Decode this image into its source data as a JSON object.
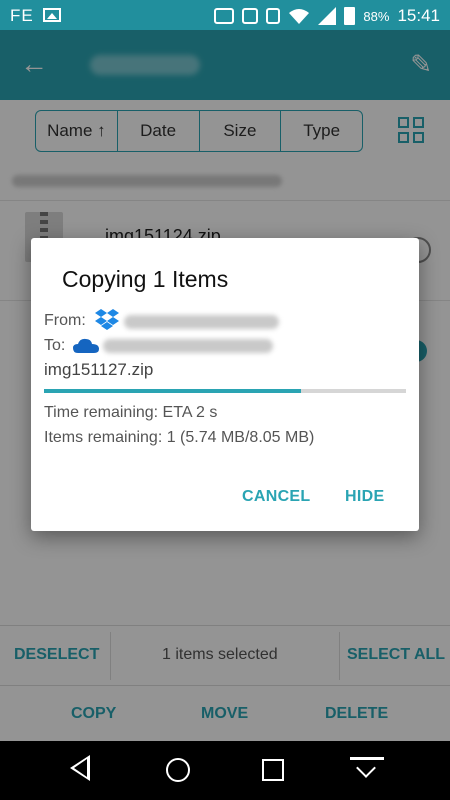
{
  "status_bar": {
    "left_text": "FE",
    "battery": "88%",
    "time": "15:41",
    "icons": [
      "image-icon",
      "sim-icon",
      "vibrate-icon",
      "nfc-icon",
      "wifi-icon",
      "signal-icon",
      "battery-icon"
    ]
  },
  "toolbar": {
    "back_icon": "arrow-left-icon",
    "edit_icon": "pencil-icon"
  },
  "sort": {
    "options": [
      "Name ↑",
      "Date",
      "Size",
      "Type"
    ],
    "view_icon": "grid-view-icon"
  },
  "file_list": {
    "items": [
      {
        "name": "img151124.zip"
      }
    ]
  },
  "dialog": {
    "title": "Copying 1 Items",
    "from_label": "From:",
    "to_label": "To:",
    "file_name": "img151127.zip",
    "progress": 0.71,
    "time_remaining": "Time remaining: ETA 2 s",
    "items_remaining": "Items remaining: 1 (5.74 MB/8.05 MB)",
    "cancel_label": "CANCEL",
    "hide_label": "HIDE"
  },
  "selection_bar": {
    "deselect_label": "DESELECT",
    "count_text": "1 items selected",
    "select_all_label": "SELECT ALL"
  },
  "action_bar": {
    "copy_label": "COPY",
    "move_label": "MOVE",
    "delete_label": "DELETE"
  },
  "colors": {
    "accent": "#2aa4b3",
    "statusbar": "#218f9d"
  }
}
